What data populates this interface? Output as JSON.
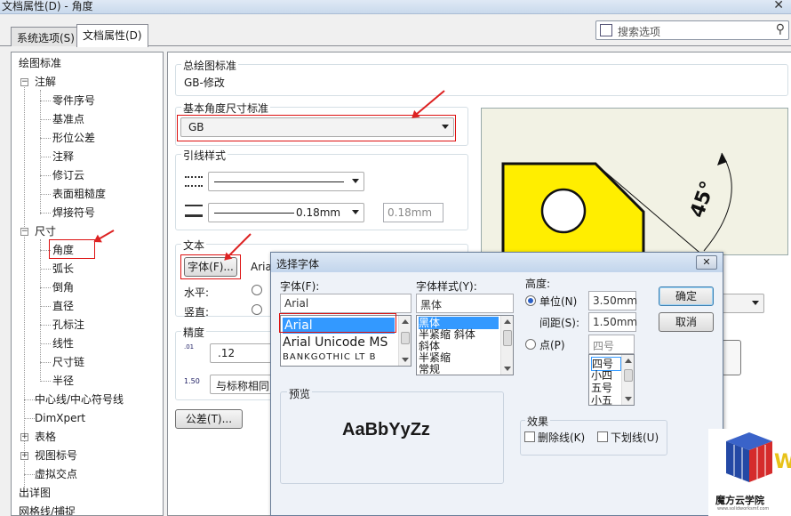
{
  "window": {
    "title": "文档属性(D) - 角度",
    "close": "✕"
  },
  "tabs": [
    {
      "label": "系统选项(S)"
    },
    {
      "label": "文档属性(D)"
    }
  ],
  "search": {
    "placeholder": "搜索选项"
  },
  "tree": {
    "items": [
      "绘图标准",
      "注解",
      "零件序号",
      "基准点",
      "形位公差",
      "注释",
      "修订云",
      "表面粗糙度",
      "焊接符号",
      "尺寸",
      "角度",
      "弧长",
      "倒角",
      "直径",
      "孔标注",
      "线性",
      "尺寸链",
      "半径",
      "中心线/中心符号线",
      "DimXpert",
      "表格",
      "视图标号",
      "虚拟交点",
      "出详图",
      "网格线/捕捉"
    ]
  },
  "overall_standard": {
    "label": "总绘图标准",
    "value": "GB-修改"
  },
  "base_standard": {
    "label": "基本角度尺寸标准",
    "value": "GB"
  },
  "leader_style": {
    "label": "引线样式",
    "thickness": "0.18mm",
    "custom_thickness": "0.18mm"
  },
  "text": {
    "label": "文本",
    "font_button": "字体(F)...",
    "font_name": "Arial",
    "horizontal": "水平:",
    "vertical": "竖直:"
  },
  "precision": {
    "label": "精度",
    "value": ".12",
    "tol_label": ".01",
    "same_as_nominal": "与标称相同"
  },
  "tolerance_button": "公差(T)...",
  "preview_drawing": {
    "angle_text": "45°"
  },
  "font_dialog": {
    "title": "选择字体",
    "font_label": "字体(F):",
    "font_value": "Arial",
    "font_list": [
      "Arial",
      "Arial Unicode MS",
      "BANKGOTHIC LT B"
    ],
    "style_label": "字体样式(Y):",
    "style_value": "黑体",
    "style_list": [
      "黑体",
      "半紧缩 斜体",
      "斜体",
      "半紧缩",
      "常规"
    ],
    "height_label": "高度:",
    "unit_label": "单位(N)",
    "unit_value": "3.50mm",
    "spacing_label": "间距(S):",
    "spacing_value": "1.50mm",
    "point_label": "点(P)",
    "point_value": "四号",
    "point_list": [
      "四号",
      "小四",
      "五号",
      "小五"
    ],
    "ok": "确定",
    "cancel": "取消",
    "preview_label": "预览",
    "preview_text": "AaBbYyZz",
    "effects_label": "效果",
    "strikeout": "删除线(K)",
    "underline": "下划线(U)"
  },
  "logo": {
    "text": "魔方云学院",
    "sub": "www.solidworksmf.com"
  },
  "colors": {
    "accent_red": "#d11111",
    "selection": "#3399ff",
    "shape_yellow": "#ffee00"
  }
}
